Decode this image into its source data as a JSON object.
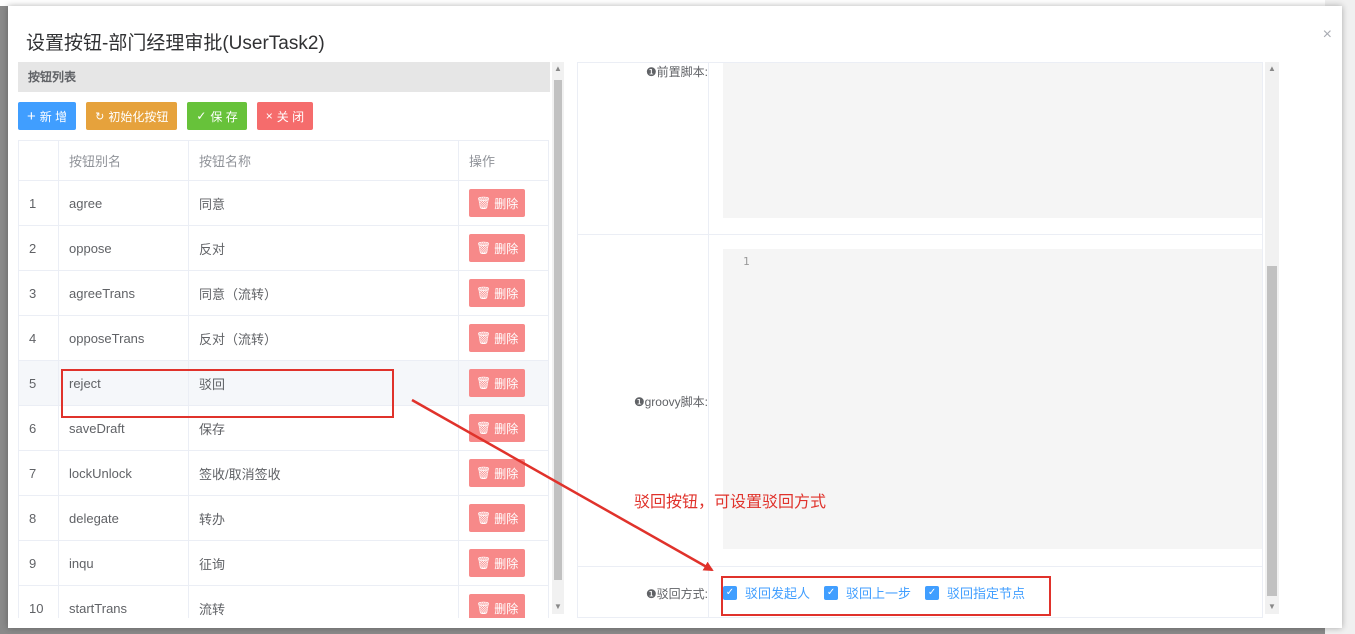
{
  "dialog": {
    "title": "设置按钮-部门经理审批(UserTask2)",
    "close_label": "×"
  },
  "left": {
    "panel_title": "按钮列表",
    "toolbar": {
      "add_label": "新 增",
      "init_label": "初始化按钮",
      "save_label": "保 存",
      "close_label": "关 闭"
    },
    "columns": [
      "",
      "按钮别名",
      "按钮名称",
      "操作"
    ],
    "delete_label": "删除",
    "rows": [
      {
        "no": "1",
        "alias": "agree",
        "name": "同意"
      },
      {
        "no": "2",
        "alias": "oppose",
        "name": "反对"
      },
      {
        "no": "3",
        "alias": "agreeTrans",
        "name": "同意（流转）"
      },
      {
        "no": "4",
        "alias": "opposeTrans",
        "name": "反对（流转）"
      },
      {
        "no": "5",
        "alias": "reject",
        "name": "驳回"
      },
      {
        "no": "6",
        "alias": "saveDraft",
        "name": "保存"
      },
      {
        "no": "7",
        "alias": "lockUnlock",
        "name": "签收/取消签收"
      },
      {
        "no": "8",
        "alias": "delegate",
        "name": "转办"
      },
      {
        "no": "9",
        "alias": "inqu",
        "name": "征询"
      },
      {
        "no": "10",
        "alias": "startTrans",
        "name": "流转"
      }
    ]
  },
  "right": {
    "pre_script_label": "❶前置脚本:",
    "groovy_label": "❶groovy脚本:",
    "groovy_line_no": "1",
    "reject_mode_label": "❶驳回方式:",
    "reject_options": [
      "驳回发起人",
      "驳回上一步",
      "驳回指定节点"
    ]
  },
  "annotation": {
    "text": "驳回按钮，可设置驳回方式",
    "color": "#e0322b"
  },
  "colors": {
    "primary": "#409eff",
    "warning": "#e6a23c",
    "success": "#67c23a",
    "danger": "#f56c6c"
  }
}
